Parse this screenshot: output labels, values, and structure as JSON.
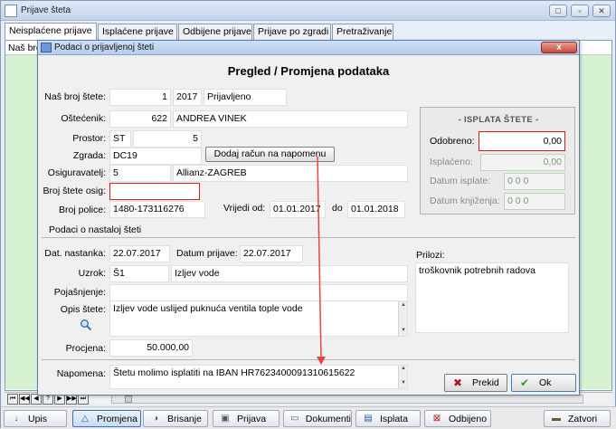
{
  "app": {
    "title": "Prijave šteta",
    "window_controls": [
      "□",
      "▫",
      "✕"
    ]
  },
  "tabs": [
    {
      "label": "Neisplaćene prijave",
      "active": true
    },
    {
      "label": "Isplaćene prijave"
    },
    {
      "label": "Odbijene prijave"
    },
    {
      "label": "Prijave po zgradi"
    },
    {
      "label": "Pretraživanje"
    }
  ],
  "list": {
    "column_header": "Naš broj"
  },
  "toolbar": {
    "buttons": [
      {
        "label": "Upis",
        "icon": "↓"
      },
      {
        "label": "Promjena",
        "icon": "△"
      },
      {
        "label": "Brisanje",
        "icon": "◑"
      },
      {
        "label": "Prijava",
        "icon": "▣"
      },
      {
        "label": "Dokumenti",
        "icon": "▭"
      },
      {
        "label": "Isplata",
        "icon": "▤"
      },
      {
        "label": "Odbijeno",
        "icon": "⊠"
      },
      {
        "label": "Zatvori",
        "icon": "▬"
      }
    ]
  },
  "dialog": {
    "title": "Podaci o prijavljenoj šteti",
    "close": "x",
    "heading": "Pregled / Promjena podataka",
    "nas_broj": {
      "label": "Naš broj štete:",
      "number": "1",
      "year": "2017",
      "status": "Prijavljeno"
    },
    "ostecenik": {
      "label": "Oštećenik:",
      "code": "622",
      "name": "ANDREA VINEK"
    },
    "prostor": {
      "label": "Prostor:",
      "code": "ST",
      "number": "5"
    },
    "zgrada": {
      "label": "Zgrada:",
      "value": "DC19",
      "button": "Dodaj račun na napomenu"
    },
    "osiguravatelj": {
      "label": "Osiguravatelj:",
      "code": "5",
      "name": "Allianz-ZAGREB"
    },
    "broj_stete_osig": {
      "label": "Broj štete osig:",
      "value": ""
    },
    "broj_police": {
      "label": "Broj police:",
      "value": "1480-173116276"
    },
    "vrijedi_od": {
      "label": "Vrijedi od:",
      "value": "01.01.2017"
    },
    "vrijedi_do": {
      "label": "do",
      "value": "01.01.2018"
    },
    "section_nastanak": "Podaci o nastaloj šteti",
    "dat_nastanka": {
      "label": "Dat. nastanka:",
      "value": "22.07.2017"
    },
    "datum_prijave": {
      "label": "Datum prijave:",
      "value": "22.07.2017"
    },
    "uzrok": {
      "label": "Uzrok:",
      "code": "Š1",
      "name": "Izljev vode"
    },
    "pojasnjenje": {
      "label": "Pojašnjenje:",
      "value": ""
    },
    "opis": {
      "label": "Opis štete:",
      "value": "Izljev vode uslijed puknuća ventila tople vode"
    },
    "procjena": {
      "label": "Procjena:",
      "value": "50.000,00"
    },
    "prilozi": {
      "label": "Prilozi:",
      "value": "troškovnik potrebnih radova"
    },
    "napomena": {
      "label": "Napomena:",
      "value": "Štetu molimo  isplatiti na IBAN   HR7623400091310615622"
    },
    "isplata": {
      "title": "- ISPLATA ŠTETE -",
      "odobreno": {
        "label": "Odobreno:",
        "value": "0,00"
      },
      "isplaceno": {
        "label": "Isplaćeno:",
        "value": "0,00"
      },
      "datum_isplate": {
        "label": "Datum isplate:",
        "value": "0 0 0"
      },
      "datum_knjizenja": {
        "label": "Datum knjiženja:",
        "value": "0 0 0"
      }
    },
    "buttons": {
      "prekid": "Prekid",
      "ok": "Ok"
    },
    "colors": {
      "accent_red": "#d01e1e",
      "annotation_arrow": "#e8453c",
      "ok_check": "#2e9e2e",
      "prekid_x": "#b3161c"
    }
  }
}
